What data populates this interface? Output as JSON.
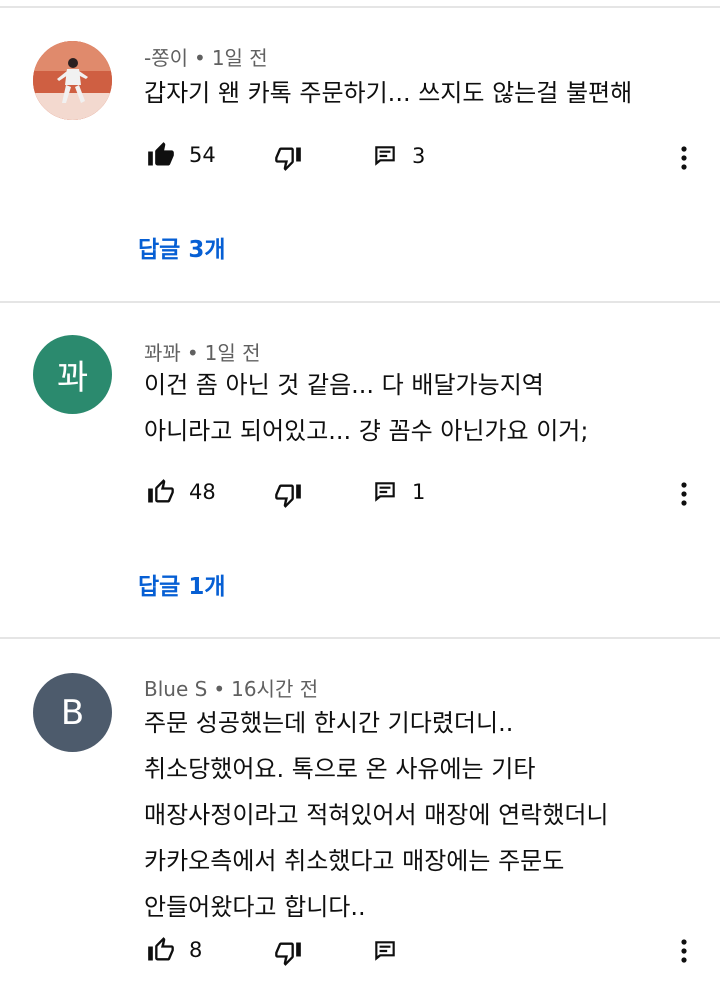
{
  "comments": [
    {
      "author": "-쫑이",
      "time": "1일 전",
      "avatar_text": "",
      "avatar_color": "#c9593c",
      "lines": [
        "갑자기 왠 카톡 주문하기... 쓰지도 않는걸 불편해"
      ],
      "likes": "54",
      "liked": true,
      "reply_count": "3",
      "replies_label": "답글 3개"
    },
    {
      "author": "꽈꽈",
      "time": "1일 전",
      "avatar_text": "꽈",
      "avatar_color": "#2b8a6e",
      "lines": [
        "이건 좀 아닌 것 같음... 다 배달가능지역",
        "아니라고 되어있고... 걍 꼼수 아닌가요 이거;"
      ],
      "likes": "48",
      "liked": false,
      "reply_count": "1",
      "replies_label": "답글 1개"
    },
    {
      "author": "Blue S",
      "time": "16시간 전",
      "avatar_text": "B",
      "avatar_color": "#4d5b6c",
      "lines": [
        "주문 성공했는데 한시간 기다렸더니..",
        "취소당했어요. 톡으로 온 사유에는 기타",
        "매장사정이라고 적혀있어서 매장에 연락했더니",
        "카카오측에서 취소했다고 매장에는 주문도",
        "안들어왔다고 합니다.."
      ],
      "likes": "8",
      "liked": false,
      "reply_count": "",
      "replies_label": ""
    }
  ],
  "icons": {
    "like": "thumb-up-icon",
    "dislike": "thumb-down-icon",
    "reply": "comment-icon",
    "more": "more-vert-icon"
  }
}
